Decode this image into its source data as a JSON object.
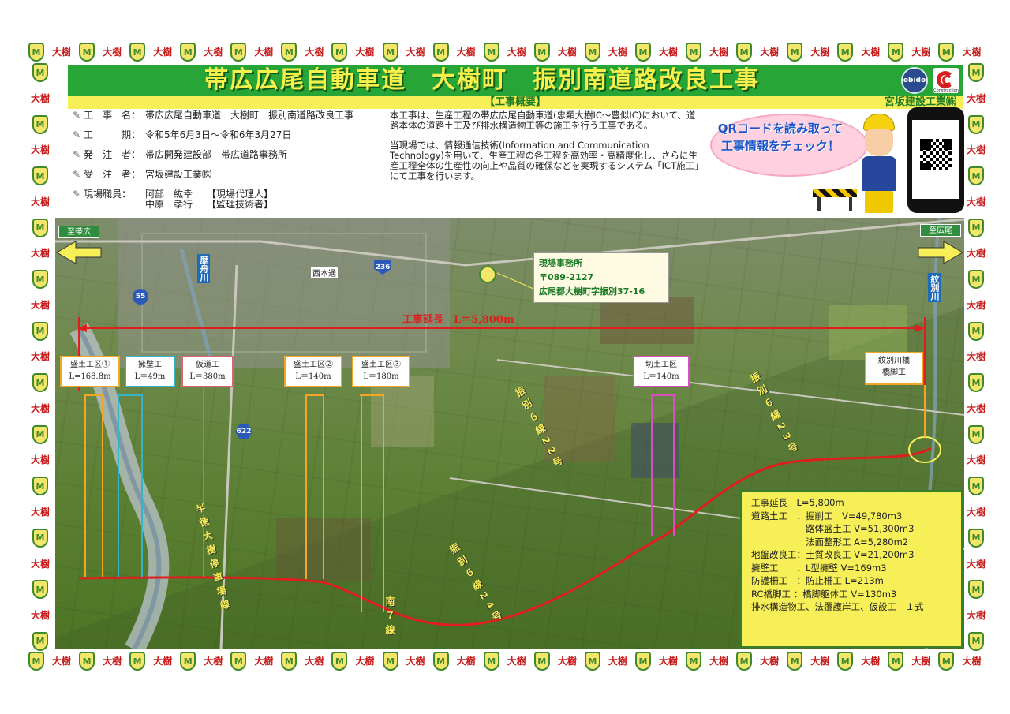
{
  "header": {
    "title": "帯広広尾自動車道　大樹町　振別南道路改良工事",
    "subtitle": "【工事概要】",
    "company": "宮坂建設工業㈱",
    "logo_obido": "obido",
    "logo_ic": "i-Construction"
  },
  "border": {
    "text": "大樹",
    "shield": "M"
  },
  "info": [
    {
      "key": "工　事　名：",
      "value": "帯広広尾自動車道　大樹町　振別南道路改良工事"
    },
    {
      "key": "工　　　期：",
      "value": "令和5年6月3日～令和6年3月27日"
    },
    {
      "key": "発　注　者：",
      "value": "帯広開発建設部　帯広道路事務所"
    },
    {
      "key": "受　注　者：",
      "value": "宮坂建設工業㈱"
    },
    {
      "key": "現場職員：",
      "value": "阿部　紘幸　　【現場代理人】\n中原　孝行　　【監理技術者】"
    }
  ],
  "description": [
    "本工事は、生産工程の帯広広尾自動車道(忠類大樹IC～豊似IC)において、道路本体の道路土工及び排水構造物工等の施工を行う工事である。",
    "当現場では、情報通信技術(Information and Communication Technology)を用いて、生産工程の各工程を高効率・高精度化し、さらに生産工程全体の生産性の向上や品質の確保などを実現するシステム「ICT施工」にて工事を行います。"
  ],
  "qr": {
    "bubble": "QRコードを読み取って\n工事情報をチェック！"
  },
  "map": {
    "dir_left": "至帯広",
    "dir_right": "至広尾",
    "office": {
      "title": "現場事務所",
      "postal": "〒089-2127",
      "address": "広尾郡大樹町字振別37-16"
    },
    "extent_label": "工事延長　L＝5,800m",
    "sections": [
      {
        "name": "盛土工区①",
        "length": "L=168.8m",
        "color": "#f2a623"
      },
      {
        "name": "擁壁工",
        "length": "L＝49m",
        "color": "#34b3c9"
      },
      {
        "name": "仮道工",
        "length": "L＝380m",
        "color": "#e0607a"
      },
      {
        "name": "盛土工区②",
        "length": "L＝140m",
        "color": "#f2a623"
      },
      {
        "name": "盛土工区③",
        "length": "L＝180m",
        "color": "#f2a623"
      },
      {
        "name": "切土工区",
        "length": "L＝140m",
        "color": "#d94fbf"
      },
      {
        "name": "紋別川橋",
        "length": "橋脚工",
        "color": "#f2a623"
      }
    ],
    "labels": {
      "river_left": "歴舟川",
      "river_right": "紋別川",
      "road1": "振別６線22号",
      "road2": "振別６線23号",
      "road3": "振別６線24号",
      "road4": "南７線",
      "rail": "半徳大樹停車場線",
      "nishihon": "西本通",
      "route55": "55",
      "route236": "236",
      "route622": "622"
    },
    "summary": [
      "工事延長　L=5,800m",
      "道路土工　：掘削工　V=49,780m3",
      "　　　　　　路体盛土工 V=51,300m3",
      "　　　　　　法面整形工 A=5,280m2",
      "地盤改良工：土質改良工 V=21,200m3",
      "擁壁工　　：L型擁壁 V=169m3",
      "防護柵工　：防止柵工 L=213m",
      "RC橋脚工 ：橋脚躯体工 V=130m3",
      "排水構造物工、法覆護岸工、仮設工　１式"
    ]
  }
}
